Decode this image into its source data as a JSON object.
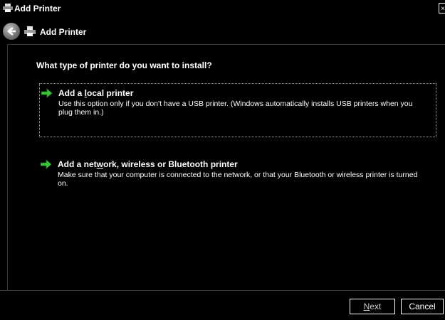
{
  "window": {
    "title": "Add Printer",
    "close_label": "×",
    "app_icon": "printer-icon"
  },
  "nav": {
    "back_icon": "back-arrow-icon",
    "icon": "printer-icon",
    "title": "Add Printer"
  },
  "main": {
    "question": "What type of printer do you want to install?",
    "options": [
      {
        "icon": "green-arrow-icon",
        "title_pre": "Add a ",
        "title_accel": "l",
        "title_post": "ocal printer",
        "description": "Use this option only if you don't have a USB printer. (Windows automatically installs USB printers when you plug them in.)",
        "focused": true
      },
      {
        "icon": "green-arrow-icon",
        "title_pre": "Add a net",
        "title_accel": "w",
        "title_post": "ork, wireless or Bluetooth printer",
        "description": "Make sure that your computer is connected to the network, or that your Bluetooth or wireless printer is turned on.",
        "focused": false
      }
    ]
  },
  "footer": {
    "next_accel": "N",
    "next_rest": "ext",
    "next_enabled": false,
    "cancel_label": "Cancel"
  },
  "colors": {
    "background": "#000000",
    "text": "#ffffff",
    "arrow_green": "#3cc43c"
  }
}
